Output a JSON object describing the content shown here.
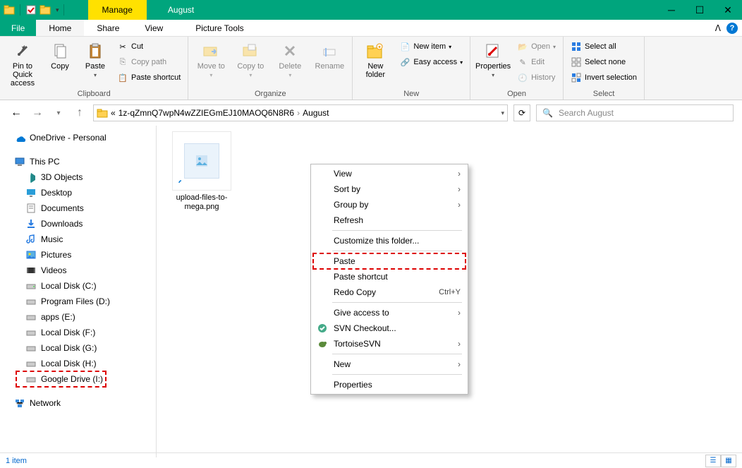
{
  "title_tabs": {
    "manage": "Manage",
    "folder_name": "August",
    "tools": "Picture Tools"
  },
  "menu": {
    "file": "File",
    "home": "Home",
    "share": "Share",
    "view": "View"
  },
  "ribbon": {
    "clipboard": {
      "label": "Clipboard",
      "pin": "Pin to Quick access",
      "copy": "Copy",
      "paste": "Paste",
      "cut": "Cut",
      "copy_path": "Copy path",
      "paste_shortcut": "Paste shortcut"
    },
    "organize": {
      "label": "Organize",
      "move_to": "Move to",
      "copy_to": "Copy to",
      "delete": "Delete",
      "rename": "Rename"
    },
    "new_group": {
      "label": "New",
      "new_folder": "New folder",
      "new_item": "New item",
      "easy_access": "Easy access"
    },
    "open_group": {
      "label": "Open",
      "properties": "Properties",
      "open": "Open",
      "edit": "Edit",
      "history": "History"
    },
    "select": {
      "label": "Select",
      "select_all": "Select all",
      "select_none": "Select none",
      "invert": "Invert selection"
    }
  },
  "address": {
    "prefix": "«",
    "part1": "1z-qZmnQ7wpN4wZZIEGmEJ10MAOQ6N8R6",
    "part2": "August"
  },
  "search": {
    "placeholder": "Search August"
  },
  "nav": {
    "onedrive": "OneDrive - Personal",
    "thispc": "This PC",
    "items": [
      "3D Objects",
      "Desktop",
      "Documents",
      "Downloads",
      "Music",
      "Pictures",
      "Videos",
      "Local Disk (C:)",
      "Program Files (D:)",
      "apps (E:)",
      "Local Disk (F:)",
      "Local Disk (G:)",
      "Local Disk (H:)",
      "Google Drive (I:)"
    ],
    "network": "Network"
  },
  "file": {
    "name": "upload-files-to-mega.png"
  },
  "context": {
    "view": "View",
    "sort_by": "Sort by",
    "group_by": "Group by",
    "refresh": "Refresh",
    "customize": "Customize this folder...",
    "paste": "Paste",
    "paste_shortcut": "Paste shortcut",
    "redo_copy": "Redo Copy",
    "redo_shortcut": "Ctrl+Y",
    "give_access": "Give access to",
    "svn_checkout": "SVN Checkout...",
    "tortoise": "TortoiseSVN",
    "new": "New",
    "properties": "Properties"
  },
  "status": {
    "count": "1 item"
  }
}
